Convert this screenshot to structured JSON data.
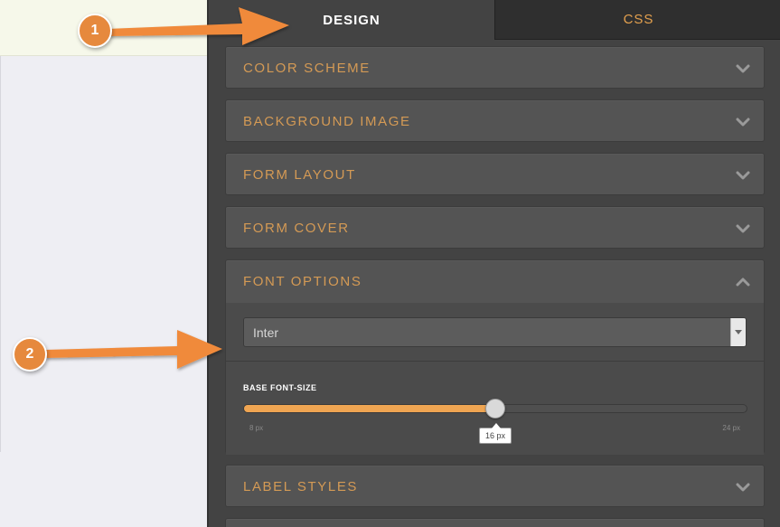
{
  "tabs": {
    "design": "DESIGN",
    "css": "CSS"
  },
  "sections": [
    {
      "title": "COLOR SCHEME",
      "expanded": false
    },
    {
      "title": "BACKGROUND IMAGE",
      "expanded": false
    },
    {
      "title": "FORM LAYOUT",
      "expanded": false
    },
    {
      "title": "FORM COVER",
      "expanded": false
    },
    {
      "title": "FONT OPTIONS",
      "expanded": true
    },
    {
      "title": "LABEL STYLES",
      "expanded": false
    }
  ],
  "font_options": {
    "font_select_value": "Inter",
    "slider_label": "BASE FONT-SIZE",
    "slider_value": "16 px",
    "slider_value_num": 16,
    "slider_min": "8 px",
    "slider_max": "24 px",
    "slider_min_num": 8,
    "slider_max_num": 24
  },
  "annotations": {
    "badge_1": "1",
    "badge_2": "2"
  },
  "colors": {
    "accent": "#e3a04e",
    "slider_fill": "#efa552",
    "arrow": "#f08a3a"
  },
  "icons": {
    "collapsed": "chevron-down-icon",
    "expanded": "chevron-up-icon",
    "select_caret": "caret-down-icon"
  }
}
